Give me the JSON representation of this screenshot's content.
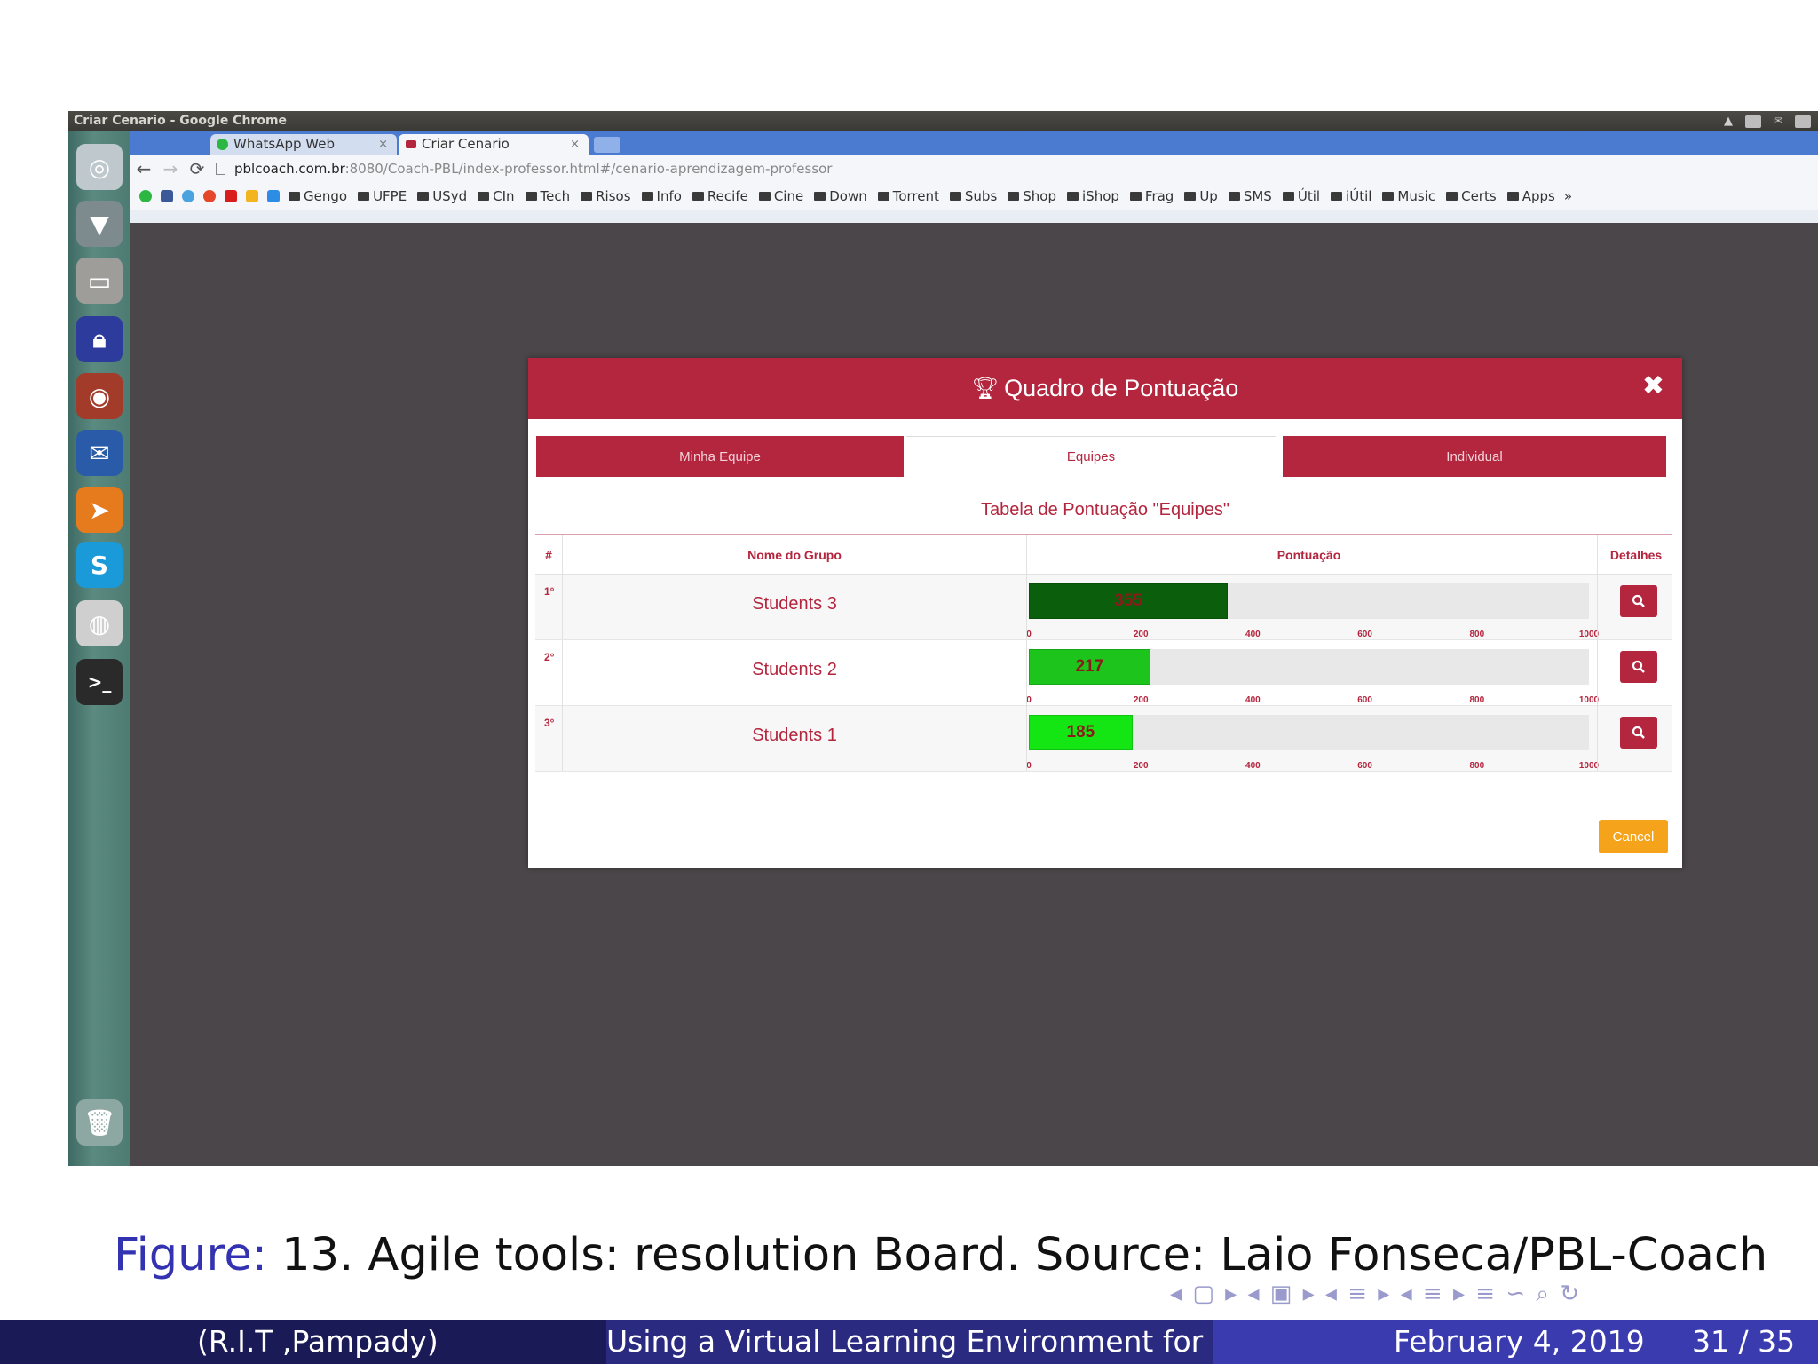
{
  "window": {
    "title": "Criar Cenario - Google Chrome"
  },
  "browser": {
    "tabs": [
      {
        "label": "WhatsApp Web",
        "close": "×"
      },
      {
        "label": "Criar Cenario",
        "close": "×"
      }
    ],
    "url_host": "pblcoach.com.br",
    "url_path": ":8080/Coach-PBL/index-professor.html#/cenario-aprendizagem-professor",
    "bookmarks": [
      "Gengo",
      "UFPE",
      "USyd",
      "CIn",
      "Tech",
      "Risos",
      "Info",
      "Recife",
      "Cine",
      "Down",
      "Torrent",
      "Subs",
      "Shop",
      "iShop",
      "Frag",
      "Up",
      "SMS",
      "Útil",
      "iÚtil",
      "Music",
      "Certs",
      "Apps"
    ],
    "bookmarks_more": "»"
  },
  "launcher": {
    "icons": [
      "ubuntu-icon",
      "installer-icon",
      "files-icon",
      "lock-icon",
      "chrome-icon",
      "thunderbird-icon",
      "arrow-app-icon",
      "skype-icon",
      "usb-icon",
      "terminal-icon",
      "trash-icon"
    ]
  },
  "modal": {
    "title": "Quadro de Pontuação",
    "close": "✖",
    "tabs": [
      "Minha Equipe",
      "Equipes",
      "Individual"
    ],
    "active_tab": "Equipes",
    "table_title": "Tabela de Pontuação \"Equipes\"",
    "columns": [
      "#",
      "Nome do Grupo",
      "Pontuação",
      "Detalhes"
    ],
    "rows": [
      {
        "rank": "1°",
        "name": "Students 3",
        "score": "355",
        "value": 355,
        "color": "#0b5e0b",
        "text_color": "#8b1a1a"
      },
      {
        "rank": "2°",
        "name": "Students 2",
        "score": "217",
        "value": 217,
        "color": "#1cc41c",
        "text_color": "#8b1a1a"
      },
      {
        "rank": "3°",
        "name": "Students 1",
        "score": "185",
        "value": 185,
        "color": "#14e614",
        "text_color": "#8b1a1a"
      }
    ],
    "scale_max": 1000,
    "ticks": [
      "0",
      "200",
      "400",
      "600",
      "800",
      "1000"
    ],
    "cancel": "Cancel"
  },
  "caption": {
    "prefix": "Figure:",
    "text": " 13. Agile tools: resolution Board. Source: Laio Fonseca/PBL-Coach"
  },
  "footer": {
    "author": "(R.I.T ,Pampady)",
    "title": "Using a Virtual Learning Environment for Pro",
    "date": "February 4, 2019",
    "page": "31 / 35"
  },
  "colors": {
    "accent": "#b4253e",
    "footer_dark": "#1a1a56",
    "footer_mid": "#2a2a80",
    "footer_light": "#3b3bb0",
    "cancel": "#f5a31a"
  }
}
